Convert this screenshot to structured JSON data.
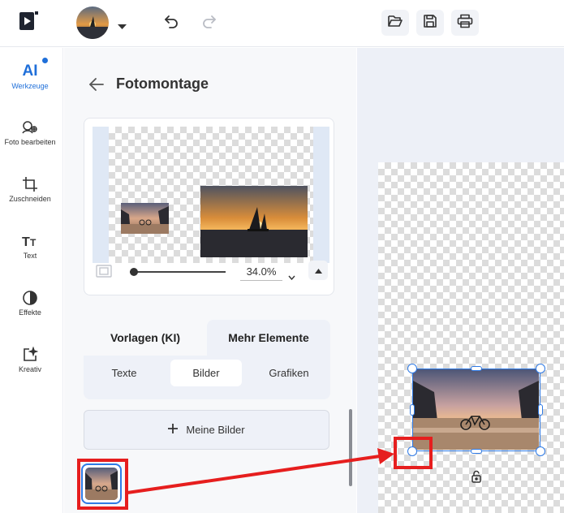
{
  "rail": {
    "items": [
      {
        "label": "Werkzeuge",
        "badge": "AI"
      },
      {
        "label": "Foto bearbeiten"
      },
      {
        "label": "Zuschneiden"
      },
      {
        "label": "Text"
      },
      {
        "label": "Effekte"
      },
      {
        "label": "Kreativ"
      }
    ]
  },
  "panel": {
    "title": "Fotomontage",
    "zoom_value": "34.0%",
    "zoom_fraction": 0.0,
    "tabs": [
      "Vorlagen (KI)",
      "Mehr Elemente"
    ],
    "active_tab": "Mehr Elemente",
    "subtabs": [
      "Texte",
      "Bilder",
      "Grafiken"
    ],
    "active_subtab": "Bilder",
    "my_images_label": "Meine Bilder"
  },
  "colors": {
    "accent": "#1f6fd9",
    "annotation_red": "#e61e1e",
    "selection_blue": "#2f7ae5"
  },
  "icons": {
    "logo": "play-logo-icon",
    "undo": "undo-icon",
    "redo": "redo-icon",
    "open": "folder-open-icon",
    "save": "save-icon",
    "print": "print-icon",
    "lock": "unlock-icon"
  }
}
